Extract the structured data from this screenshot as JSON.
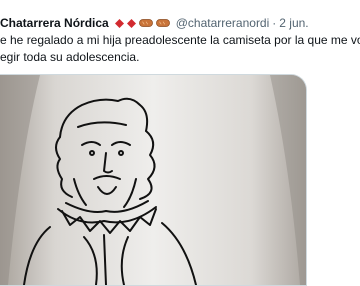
{
  "tweet": {
    "author": {
      "display_name": "Chatarrera Nórdica",
      "handle": "@chatarreranordi",
      "emoji_icons": [
        "red-diamond-icon",
        "red-diamond-icon",
        "sausage-icon",
        "sausage-icon"
      ]
    },
    "separator": "·",
    "date": "2 jun.",
    "text_lines": [
      "e he regalado a mi hija preadolescente la camiseta por la que me vo",
      "egir toda su adolescencia."
    ],
    "media": {
      "description_icon": "shakespeare-line-drawing-tshirt-photo"
    }
  },
  "colors": {
    "text": "#0f1419",
    "secondary": "#536471",
    "diamond": "#d22a2f",
    "sausage": "#c9743a",
    "border": "#cfd9de"
  }
}
